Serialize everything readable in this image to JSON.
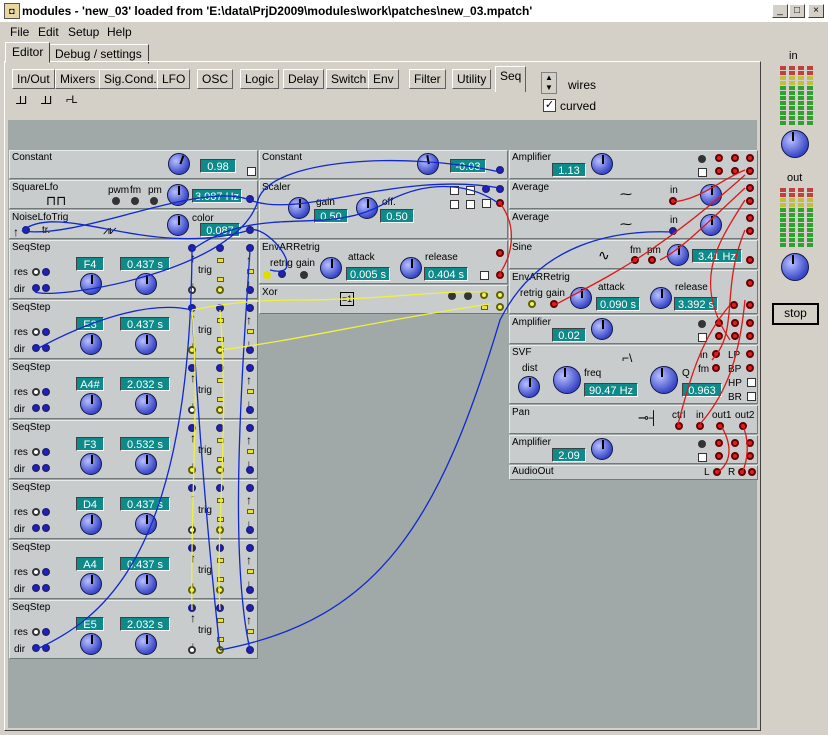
{
  "window": {
    "title": "modules - 'new_03' loaded from 'E:\\data\\PrjD2009\\modules\\work\\patches\\new_03.mpatch'",
    "min": "_",
    "max": "□",
    "close": "×"
  },
  "menu": [
    "File",
    "Edit",
    "Setup",
    "Help"
  ],
  "main_tabs": [
    "Editor",
    "Debug / settings"
  ],
  "cat_tabs": [
    "In/Out",
    "Mixers",
    "Sig.Cond.",
    "LFO",
    "OSC",
    "Logic",
    "Delay",
    "Switch",
    "Env",
    "Filter",
    "Utility",
    "Seq"
  ],
  "seq_icons": [
    "⅃⅃",
    "⅃⅃",
    "⌐L"
  ],
  "options": {
    "wires": "wires",
    "curved": "curved",
    "curved_check": "✓"
  },
  "meters": {
    "in": "in",
    "out": "out",
    "stop": "stop"
  },
  "modules": {
    "constant1": {
      "title": "Constant",
      "value": "0.98"
    },
    "constant2": {
      "title": "Constant",
      "value": "-0.03"
    },
    "squarelfo": {
      "title": "SquareLfo",
      "pwm": "pwm",
      "fm": "fm",
      "pm": "pm",
      "value": "3.087 Hz"
    },
    "noiselfo": {
      "title": "NoiseLfoTrig",
      "tr": "tr.",
      "color": "color",
      "value": "0.087"
    },
    "scaler": {
      "title": "Scaler",
      "gain": "gain",
      "off": "off.",
      "gain_val": "0.50",
      "off_val": "0.50"
    },
    "envar1": {
      "title": "EnvARRetrig",
      "retrig": "retrig",
      "gain": "gain",
      "attack": "attack",
      "release": "release",
      "attack_val": "0.005 s",
      "release_val": "0.404 s"
    },
    "xor": {
      "title": "Xor",
      "sym": "=1"
    },
    "amp1": {
      "title": "Amplifier",
      "value": "1.13"
    },
    "avg1": {
      "title": "Average",
      "in": "in"
    },
    "avg2": {
      "title": "Average",
      "in": "in"
    },
    "sine": {
      "title": "Sine",
      "fm": "fm",
      "pm": "pm",
      "value": "3.41 Hz"
    },
    "envar2": {
      "title": "EnvARRetrig",
      "retrig": "retrig",
      "gain": "gain",
      "attack": "attack",
      "release": "release",
      "attack_val": "0.090 s",
      "release_val": "3.392 s"
    },
    "amp2": {
      "title": "Amplifier",
      "value": "0.02"
    },
    "svf": {
      "title": "SVF",
      "dist": "dist",
      "freq": "freq",
      "q": "Q",
      "in": "in",
      "fm": "fm",
      "lp": "LP",
      "bp": "BP",
      "hp": "HP",
      "br": "BR",
      "freq_val": "90.47 Hz",
      "q_val": "0.963"
    },
    "pan": {
      "title": "Pan",
      "ctrl": "ctrl",
      "in": "in",
      "out1": "out1",
      "out2": "out2"
    },
    "amp3": {
      "title": "Amplifier",
      "value": "2.09"
    },
    "audioout": {
      "title": "AudioOut",
      "l": "L",
      "r": "R"
    }
  },
  "seqsteps": [
    {
      "title": "SeqStep",
      "note": "F4",
      "time": "0.437 s"
    },
    {
      "title": "SeqStep",
      "note": "E3",
      "time": "0.437 s"
    },
    {
      "title": "SeqStep",
      "note": "A4#",
      "time": "2.032 s"
    },
    {
      "title": "SeqStep",
      "note": "F3",
      "time": "0.532 s"
    },
    {
      "title": "SeqStep",
      "note": "D4",
      "time": "0.437 s"
    },
    {
      "title": "SeqStep",
      "note": "A4",
      "time": "0.437 s"
    },
    {
      "title": "SeqStep",
      "note": "E5",
      "time": "2.032 s"
    }
  ],
  "seq_labels": {
    "res": "res",
    "dir": "dir",
    "trig": "trig"
  },
  "colors": {
    "canvas": "#a0a8a8",
    "value_bg": "#0e8a8a",
    "cable_blue": "#1028d0",
    "cable_red": "#e01818",
    "cable_yellow": "#f0f040"
  }
}
